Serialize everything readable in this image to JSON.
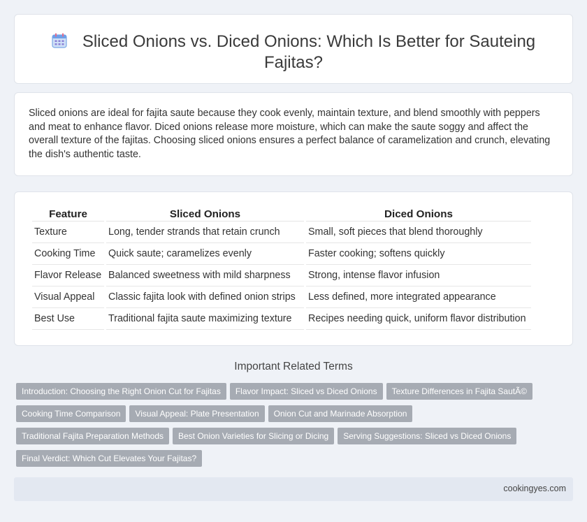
{
  "header": {
    "title_line1": "Sliced Onions vs. Diced Onions: Which Is Better for Sauteing",
    "title_line2": "Fajitas?",
    "icon": "calendar-icon"
  },
  "intro": {
    "text": "Sliced onions are ideal for fajita saute because they cook evenly, maintain texture, and blend smoothly with peppers and meat to enhance flavor. Diced onions release more moisture, which can make the saute soggy and affect the overall texture of the fajitas. Choosing sliced onions ensures a perfect balance of caramelization and crunch, elevating the dish's authentic taste."
  },
  "table": {
    "headers": [
      "Feature",
      "Sliced Onions",
      "Diced Onions"
    ],
    "rows": [
      [
        "Texture",
        "Long, tender strands that retain crunch",
        "Small, soft pieces that blend thoroughly"
      ],
      [
        "Cooking Time",
        "Quick saute; caramelizes evenly",
        "Faster cooking; softens quickly"
      ],
      [
        "Flavor Release",
        "Balanced sweetness with mild sharpness",
        "Strong, intense flavor infusion"
      ],
      [
        "Visual Appeal",
        "Classic fajita look with defined onion strips",
        "Less defined, more integrated appearance"
      ],
      [
        "Best Use",
        "Traditional fajita saute maximizing texture",
        "Recipes needing quick, uniform flavor distribution"
      ]
    ]
  },
  "related": {
    "title": "Important Related Terms",
    "tags": [
      [
        "Introduction: Choosing the Right Onion Cut for Fajitas",
        "Flavor Impact: Sliced vs Diced Onions",
        "Texture Differences in Fajita SautÃ©"
      ],
      [
        "Cooking Time Comparison",
        "Visual Appeal: Plate Presentation",
        "Onion Cut and Marinade Absorption"
      ],
      [
        "Traditional Fajita Preparation Methods",
        "Best Onion Varieties for Slicing or Dicing",
        "Serving Suggestions: Sliced vs Diced Onions"
      ],
      [
        "Final Verdict: Which Cut Elevates Your Fajitas?"
      ]
    ]
  },
  "footer": {
    "site": "cookingyes.com"
  }
}
